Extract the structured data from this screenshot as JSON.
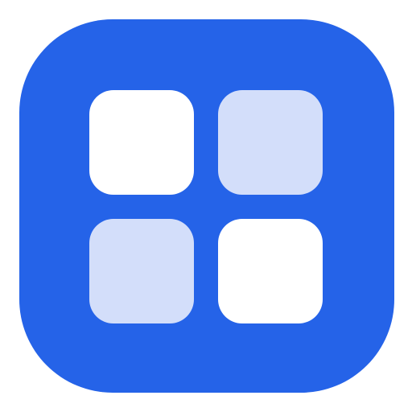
{
  "icon": {
    "name": "app-grid-icon",
    "colors": {
      "background": "#2563e8",
      "tile_solid": "#ffffff",
      "tile_faded": "#d3defa"
    },
    "tiles": [
      {
        "name": "grid-tile-top-left",
        "style": "solid"
      },
      {
        "name": "grid-tile-top-right",
        "style": "faded"
      },
      {
        "name": "grid-tile-bottom-left",
        "style": "faded"
      },
      {
        "name": "grid-tile-bottom-right",
        "style": "solid"
      }
    ]
  }
}
